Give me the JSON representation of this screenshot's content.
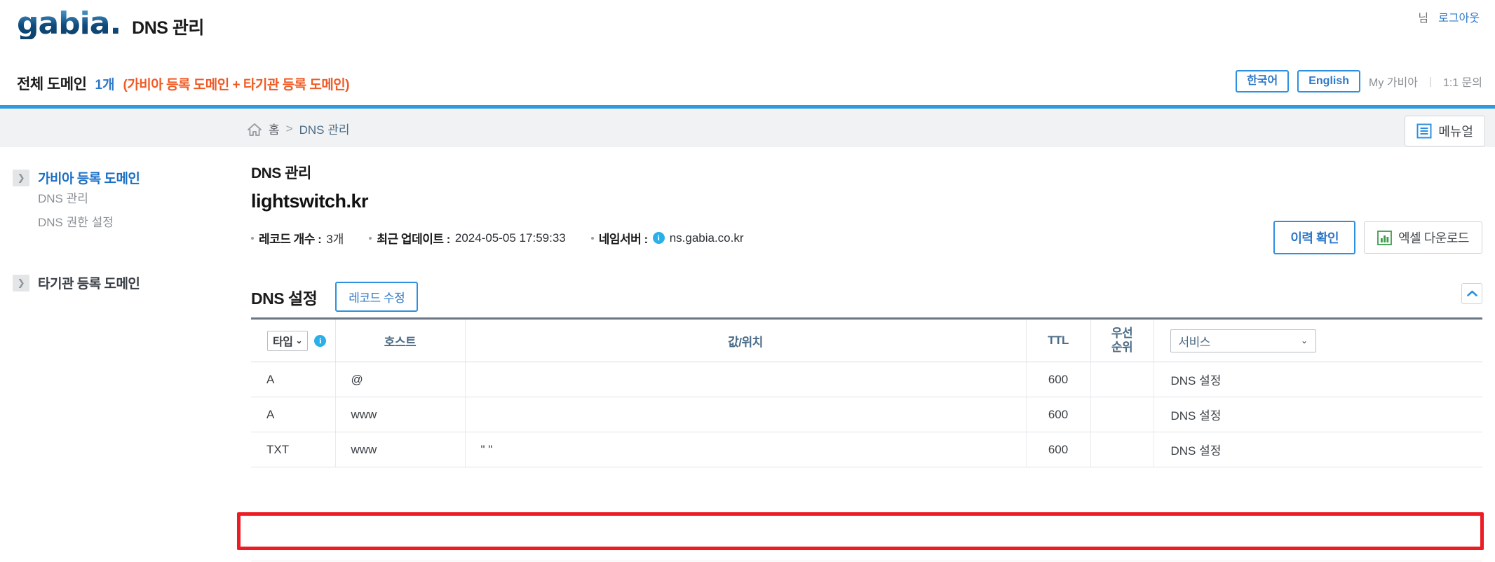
{
  "header": {
    "logo_text": "gabia.",
    "page_title": "DNS 관리",
    "user_suffix": "님",
    "logout_label": "로그아웃"
  },
  "subheader": {
    "total_domain_label": "전체 도메인",
    "total_domain_count": "1개",
    "total_domain_note": "(가비아 등록 도메인 + 타기관 등록 도메인)",
    "lang_korean": "한국어",
    "lang_english": "English",
    "my_gabia": "My 가비아",
    "separator": "|",
    "inquiry": "1:1 문의"
  },
  "breadcrumb": {
    "home": "홈",
    "separator": ">",
    "current": "DNS 관리",
    "manual_button": "메뉴얼"
  },
  "sidebar": {
    "groups": [
      {
        "label": "가비아 등록 도메인",
        "active": true,
        "items": [
          "DNS 관리",
          "DNS 권한 설정"
        ]
      },
      {
        "label": "타기관 등록 도메인",
        "active": false,
        "items": []
      }
    ]
  },
  "main": {
    "title": "DNS 관리",
    "domain": "lightswitch.kr",
    "meta": [
      {
        "key": "레코드 개수 :",
        "value": "3개"
      },
      {
        "key": "최근 업데이트 :",
        "value": "2024-05-05 17:59:33"
      },
      {
        "key": "네임서버 :",
        "value": "ns.gabia.co.kr",
        "has_info_icon": true
      }
    ],
    "history_button": "이력 확인",
    "excel_button": "엑셀 다운로드",
    "dns_settings_title": "DNS 설정",
    "record_edit_button": "레코드 수정"
  },
  "table": {
    "columns": {
      "type_select": "타입",
      "host": "호스트",
      "value": "값/위치",
      "ttl": "TTL",
      "priority_line1": "우선",
      "priority_line2": "순위",
      "service_select": "서비스"
    },
    "rows": [
      {
        "type": "A",
        "host": "@",
        "value": "",
        "ttl": "600",
        "priority": "",
        "service": "DNS 설정",
        "highlighted": false
      },
      {
        "type": "A",
        "host": "www",
        "value": "",
        "ttl": "600",
        "priority": "",
        "service": "DNS 설정",
        "highlighted": false
      },
      {
        "type": "TXT",
        "host": "www",
        "value": "\"    \"",
        "ttl": "600",
        "priority": "",
        "service": "DNS 설정",
        "highlighted": true
      }
    ]
  },
  "colors": {
    "brand_blue": "#2e9be0",
    "link_blue": "#2e78c8",
    "orange_note": "#f15a24",
    "highlight_red": "#ed1c24",
    "header_text": "#4a6b86"
  }
}
